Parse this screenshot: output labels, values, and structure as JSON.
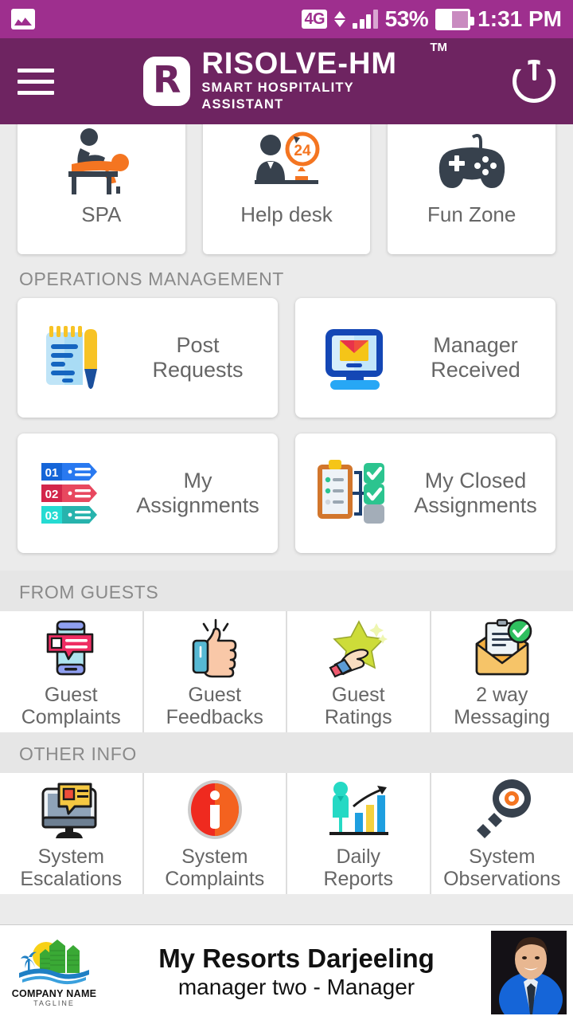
{
  "status_bar": {
    "photo_icon": "image-icon",
    "network": "4G",
    "data_arrows": "up-down-arrows-icon",
    "signal": "signal-bars-icon",
    "battery_percent": "53%",
    "battery_icon": "battery-icon",
    "time": "1:31 PM"
  },
  "app_bar": {
    "menu_icon": "hamburger-menu-icon",
    "logo_letter": "R",
    "title": "RISOLVE-HM",
    "subtitle": "SMART HOSPITALITY ASSISTANT",
    "trademark": "TM",
    "power_icon": "power-icon",
    "bar_color": "#6e2461"
  },
  "services_row": [
    {
      "label": "SPA",
      "icon": "spa-massage-icon"
    },
    {
      "label": "Help desk",
      "icon": "help-desk-24h-icon"
    },
    {
      "label": "Fun Zone",
      "icon": "gamepad-icon"
    }
  ],
  "sections": {
    "operations": {
      "title": "OPERATIONS MANAGEMENT",
      "cards": [
        {
          "label": "Post\nRequests",
          "line1": "Post",
          "line2": "Requests",
          "icon": "notepad-pen-icon"
        },
        {
          "label": "Manager\nReceived",
          "line1": "Manager",
          "line2": "Received",
          "icon": "monitor-mail-icon"
        },
        {
          "label": "My\nAssignments",
          "line1": "My",
          "line2": "Assignments",
          "icon": "numbered-tags-icon"
        },
        {
          "label": "My Closed\nAssignments",
          "line1": "My Closed",
          "line2": "Assignments",
          "icon": "clipboard-checklist-icon"
        }
      ]
    },
    "from_guests": {
      "title": "FROM GUESTS",
      "tiles": [
        {
          "line1": "Guest",
          "line2": "Complaints",
          "icon": "phone-complaint-icon"
        },
        {
          "line1": "Guest",
          "line2": "Feedbacks",
          "icon": "thumbs-up-icon"
        },
        {
          "line1": "Guest",
          "line2": "Ratings",
          "icon": "star-rating-icon"
        },
        {
          "line1": "2 way",
          "line2": "Messaging",
          "icon": "envelope-check-icon"
        }
      ]
    },
    "other_info": {
      "title": "OTHER INFO",
      "tiles": [
        {
          "line1": "System",
          "line2": "Escalations",
          "icon": "monitor-alert-icon"
        },
        {
          "line1": "System",
          "line2": "Complaints",
          "icon": "info-circle-icon"
        },
        {
          "line1": "Daily",
          "line2": "Reports",
          "icon": "bar-chart-growth-icon"
        },
        {
          "line1": "System",
          "line2": "Observations",
          "icon": "magnifier-eye-icon"
        }
      ]
    }
  },
  "footer": {
    "logo_icon": "resort-company-logo",
    "logo_text": "COMPANY NAME",
    "logo_tagline": "TAGLINE",
    "property_name": "My Resorts Darjeeling",
    "user_line": "manager two - Manager",
    "avatar": "user-avatar-photo"
  },
  "colors": {
    "status_bar": "#9e2f8e",
    "app_bar": "#6e2461",
    "page_background": "#ebebeb",
    "card_background": "#ffffff",
    "section_label": "#8a8a8a",
    "tile_label": "#666666"
  }
}
